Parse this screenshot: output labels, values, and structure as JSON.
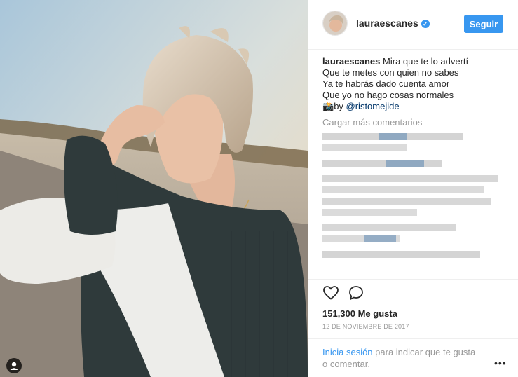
{
  "header": {
    "username": "lauraescanes",
    "verified_icon": "verified-badge-icon",
    "follow_label": "Seguir"
  },
  "caption": {
    "username": "lauraescanes",
    "line1": "Mira que te lo advertí",
    "line2": "Que te metes con quien no sabes",
    "line3": "Ya te habrás dado cuenta amor",
    "line4": "Que yo no hago cosas normales",
    "camera_emoji": "📸",
    "credit_prefix": "by ",
    "mention": "@ristomejide"
  },
  "comments": {
    "load_more": "Cargar más comentarios"
  },
  "actions": {
    "like_icon": "heart-icon",
    "comment_icon": "comment-icon"
  },
  "likes": "151,300 Me gusta",
  "date": "12 DE NOVIEMBRE DE 2017",
  "login_prompt": {
    "link": "Inicia sesión",
    "rest_line1": " para indicar que te gusta",
    "line2": "o comentar."
  },
  "more_options": "•••",
  "colors": {
    "accent": "#3897f0",
    "text": "#262626",
    "muted": "#999999",
    "mention": "#003569"
  }
}
